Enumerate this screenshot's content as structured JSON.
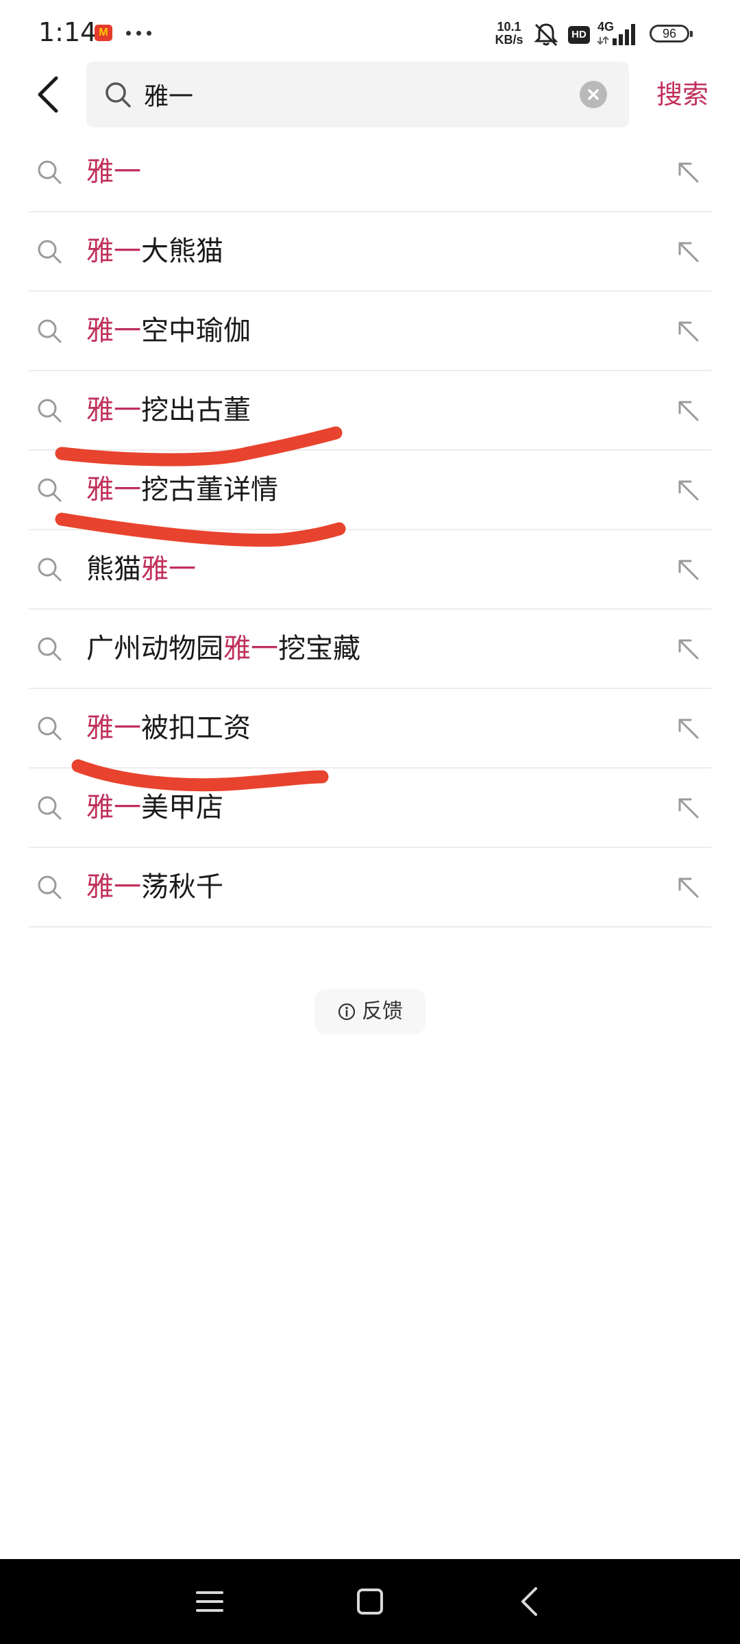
{
  "status_bar": {
    "time": "1:14",
    "app_icon_label": "M",
    "net_speed_value": "10.1",
    "net_speed_unit": "KB/s",
    "hd_label": "HD",
    "network_type": "4G",
    "battery_level": "96"
  },
  "search": {
    "query": "雅一",
    "submit_label": "搜索"
  },
  "suggestions": [
    {
      "text": "雅一"
    },
    {
      "text": "雅一大熊猫"
    },
    {
      "text": "雅一空中瑜伽"
    },
    {
      "text": "雅一挖出古董"
    },
    {
      "text": "雅一挖古董详情"
    },
    {
      "text": "熊猫雅一"
    },
    {
      "text": "广州动物园雅一挖宝藏"
    },
    {
      "text": "雅一被扣工资"
    },
    {
      "text": "雅一美甲店"
    },
    {
      "text": "雅一荡秋千"
    }
  ],
  "feedback": {
    "label": "反馈"
  },
  "colors": {
    "accent": "#c0305c",
    "annotation": "#e8432e"
  },
  "icons": {
    "back": "chevron-left-icon",
    "search": "search-icon",
    "clear": "clear-icon",
    "fill_suggestion": "arrow-up-left-icon",
    "feedback": "info-icon",
    "nav_menu": "menu-icon",
    "nav_home": "home-square-icon",
    "nav_back": "back-triangle-icon"
  }
}
